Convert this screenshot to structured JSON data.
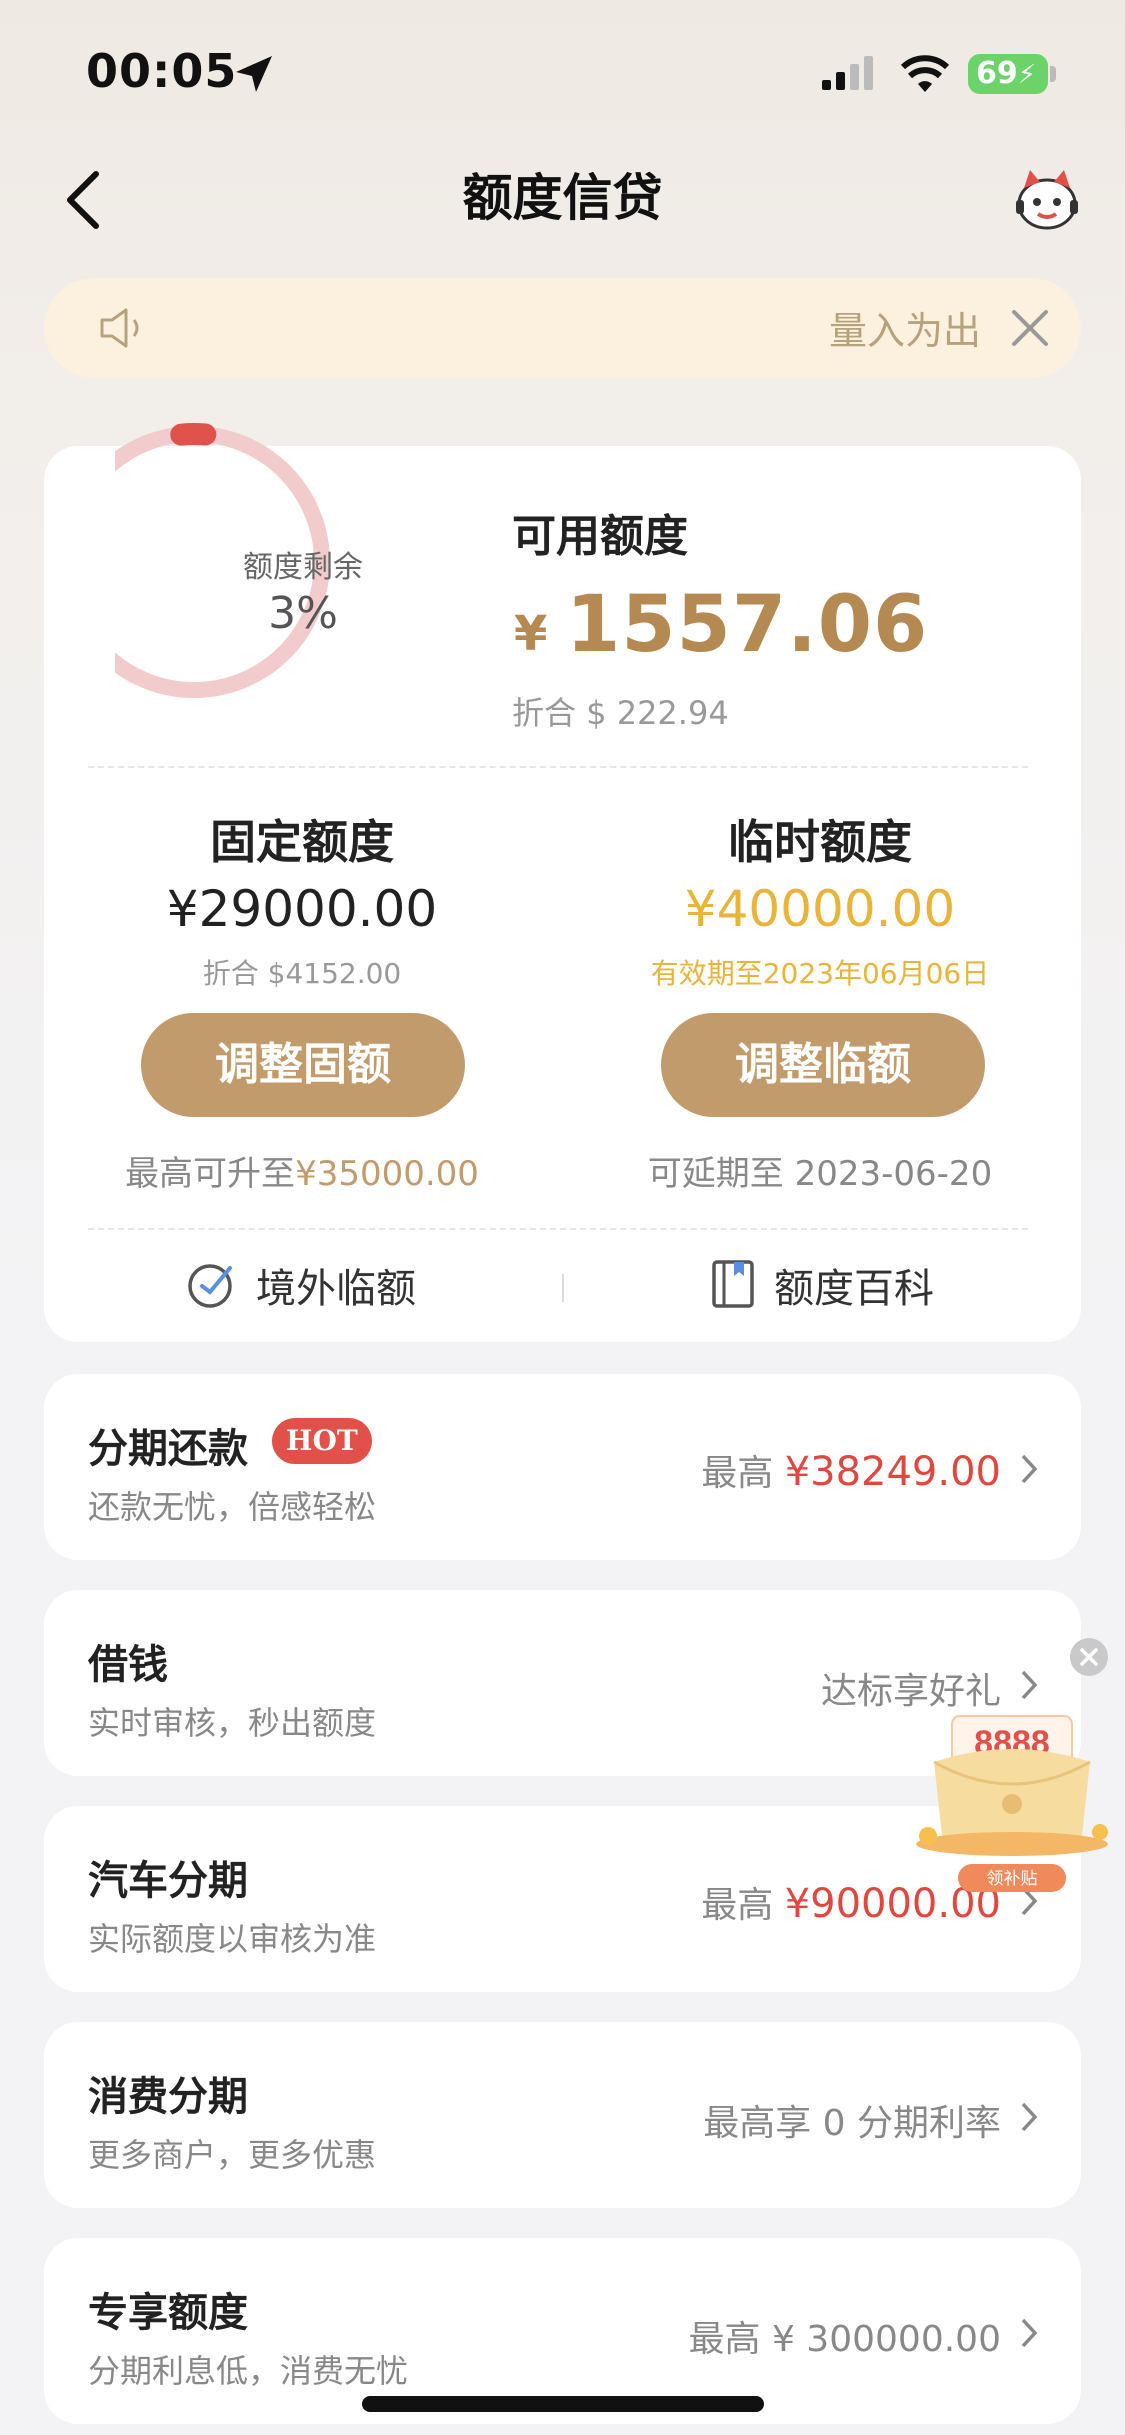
{
  "status_bar": {
    "time": "00:05",
    "battery": "69"
  },
  "header": {
    "title": "额度信贷"
  },
  "notice": {
    "text": "量入为出"
  },
  "summary": {
    "ring_label": "额度剩余",
    "ring_percent": "3%",
    "ring_fraction": 0.03,
    "available_label": "可用额度",
    "available_currency": "¥",
    "available_amount": "1557.06",
    "available_usd": "折合 $ 222.94"
  },
  "fixed": {
    "title": "固定额度",
    "amount": "¥29000.00",
    "usd": "折合 $4152.00",
    "button": "调整固额",
    "foot_prefix": "最高可升至",
    "foot_value": "¥35000.00"
  },
  "temp": {
    "title": "临时额度",
    "amount": "¥40000.00",
    "validity": "有效期至2023年06月06日",
    "button": "调整临额",
    "foot": "可延期至 2023-06-20"
  },
  "links": {
    "overseas": "境外临额",
    "wiki": "额度百科"
  },
  "rows": [
    {
      "title": "分期还款",
      "badge": "HOT",
      "sub": "还款无忧，倍感轻松",
      "right_prefix": "最高 ",
      "right_value": "¥38249.00"
    },
    {
      "title": "借钱",
      "sub": "实时审核，秒出额度",
      "right_text": "达标享好礼"
    },
    {
      "title": "汽车分期",
      "sub": "实际额度以审核为准",
      "right_prefix": "最高 ",
      "right_value": "¥90000.00"
    },
    {
      "title": "消费分期",
      "sub": "更多商户，更多优惠",
      "right_text": "最高享 0 分期利率"
    },
    {
      "title": "专享额度",
      "sub": "分期利息低，消费无忧",
      "right_text": "最高 ¥ 300000.00"
    }
  ],
  "promo": {
    "amount": "8888",
    "label": "领补贴"
  },
  "colors": {
    "gold": "#c29b6d",
    "red": "#e0473f",
    "ring": "#f2cccc",
    "ring_arc": "#e0534d"
  }
}
